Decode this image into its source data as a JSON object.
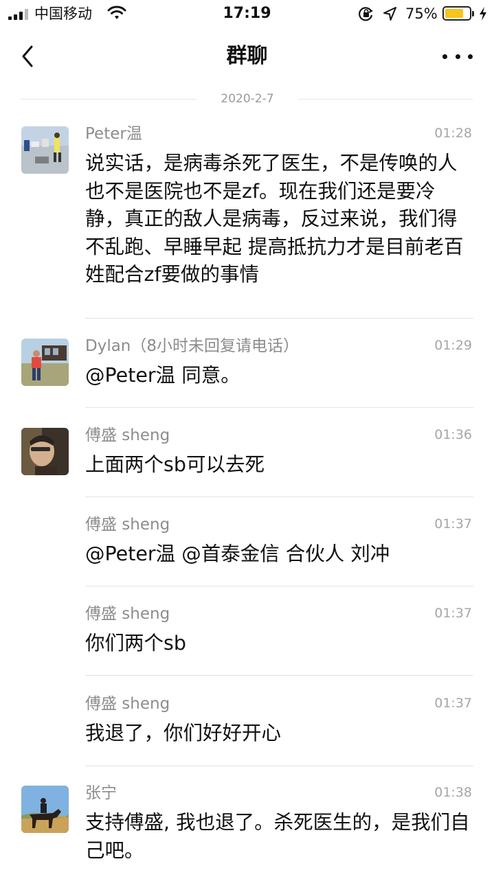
{
  "status_bar": {
    "carrier": "中国移动",
    "time": "17:19",
    "battery_percent": "75%",
    "battery_level": 0.75,
    "battery_color": "#f7c51b"
  },
  "nav": {
    "title": "群聊"
  },
  "date_separator": "2020-2-7",
  "messages": [
    {
      "sender": "Peter温",
      "time": "01:28",
      "text": "说实话，是病毒杀死了医生，不是传唤的人也不是医院也不是zf。现在我们还是要冷静，真正的敌人是病毒，反过来说，我们得不乱跑、早睡早起 提高抵抗力才是目前老百姓配合zf要做的事情"
    },
    {
      "sender": "Dylan（8小时未回复请电话）",
      "time": "01:29",
      "text": "@Peter温 同意。"
    },
    {
      "sender": "傅盛 sheng",
      "time": "01:36",
      "text": "上面两个sb可以去死"
    },
    {
      "sender": "傅盛 sheng",
      "time": "01:37",
      "text": "@Peter温 @首泰金信 合伙人 刘冲"
    },
    {
      "sender": "傅盛 sheng",
      "time": "01:37",
      "text": "你们两个sb"
    },
    {
      "sender": "傅盛 sheng",
      "time": "01:37",
      "text": "我退了，你们好好开心"
    },
    {
      "sender": "张宁",
      "time": "01:38",
      "text": "支持傅盛, 我也退了。杀死医生的，是我们自己吧。"
    }
  ]
}
